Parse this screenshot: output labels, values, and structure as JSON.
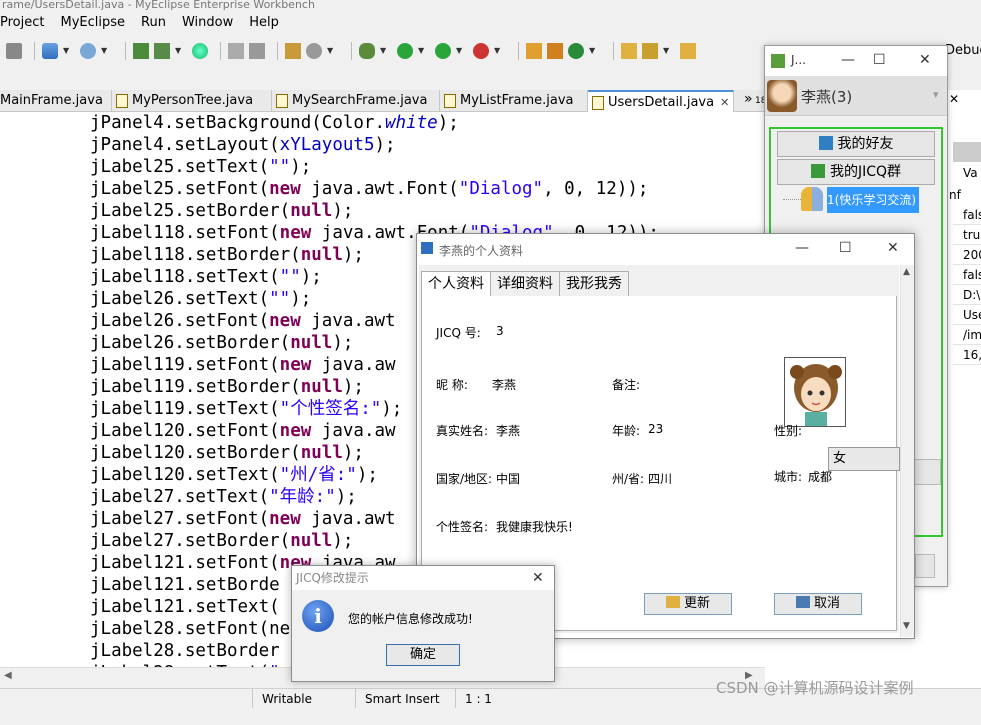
{
  "app": {
    "title": "rame/UsersDetail.java - MyEclipse Enterprise Workbench",
    "menus": [
      "Project",
      "MyEclipse",
      "Run",
      "Window",
      "Help"
    ]
  },
  "editor": {
    "tabs": [
      {
        "label": "MainFrame.java",
        "active": false
      },
      {
        "label": "MyPersonTree.java",
        "active": false
      },
      {
        "label": "MySearchFrame.java",
        "active": false
      },
      {
        "label": "MyListFrame.java",
        "active": false
      },
      {
        "label": "UsersDetail.java",
        "active": true
      }
    ],
    "tab_overflow": "»",
    "tab_overflow_count": "18",
    "code_lines": [
      "jPanel4.setBackground(Color.white);",
      "jPanel4.setLayout(xYLayout5);",
      "jLabel25.setText(\"\");",
      "jLabel25.setFont(new java.awt.Font(\"Dialog\", 0, 12));",
      "jLabel25.setBorder(null);",
      "jLabel118.setFont(new java.awt.Font(\"Dialog\", 0, 12));",
      "jLabel118.setBorder(null);",
      "jLabel118.setText(\"\");",
      "jLabel26.setText(\"\");",
      "jLabel26.setFont(new java.awt",
      "jLabel26.setBorder(null);",
      "jLabel119.setFont(new java.aw",
      "jLabel119.setBorder(null);",
      "jLabel119.setText(\"个性签名:\");",
      "jLabel120.setFont(new java.aw",
      "jLabel120.setBorder(null);",
      "jLabel120.setText(\"州/省:\");",
      "jLabel27.setText(\"年龄:\");",
      "jLabel27.setFont(new java.awt",
      "jLabel27.setBorder(null);",
      "jLabel121.setFont(new java.aw",
      "jLabel121.setBorde",
      "jLabel121.setText(",
      "jLabel28.setFont(ne",
      "jLabel28.setBorder",
      "jLabel28.setText(\""
    ]
  },
  "right_panel": {
    "debug_label": "Debug",
    "column_header": "Va",
    "inf": "nf",
    "values": [
      "fals",
      "tru",
      "200",
      "fals",
      "D:\\",
      "Use",
      "/im",
      "16,"
    ]
  },
  "status_bar": {
    "writable": "Writable",
    "insert_mode": "Smart Insert",
    "position": "1 : 1"
  },
  "jicq_window": {
    "title": "J...",
    "user_name": "李燕(3)",
    "friends_button": "我的好友",
    "groups_button": "我的JICQ群",
    "tree_item": "1(快乐学习交流)"
  },
  "profile_dialog": {
    "title": "李燕的个人资料",
    "tabs": [
      "个人资料",
      "详细资料",
      "我形我秀"
    ],
    "jicq_no_label": "JICQ 号:",
    "jicq_no": "3",
    "nickname_label": "昵    称:",
    "nickname": "李燕",
    "remark_label": "备注:",
    "realname_label": "真实姓名:",
    "realname": "李燕",
    "age_label": "年龄:",
    "age": "23",
    "gender_label": "性别:",
    "gender": "女",
    "country_label": "国家/地区:",
    "country": "中国",
    "province_label": "州/省:",
    "province": "四川",
    "city_label": "城市:",
    "city": "成都",
    "signature_label": "个性签名:",
    "signature": "我健康我快乐!",
    "update_button": "更新",
    "cancel_button": "取消"
  },
  "message_dialog": {
    "title": "JICQ修改提示",
    "message": "您的帐户信息修改成功!",
    "ok_button": "确定"
  },
  "watermark": "CSDN @计算机源码设计案例",
  "colors": {
    "keyword": "#7f0055",
    "string": "#2a00ff",
    "field": "#0000c0",
    "selection": "#3399ff",
    "green_border": "#32c832"
  }
}
